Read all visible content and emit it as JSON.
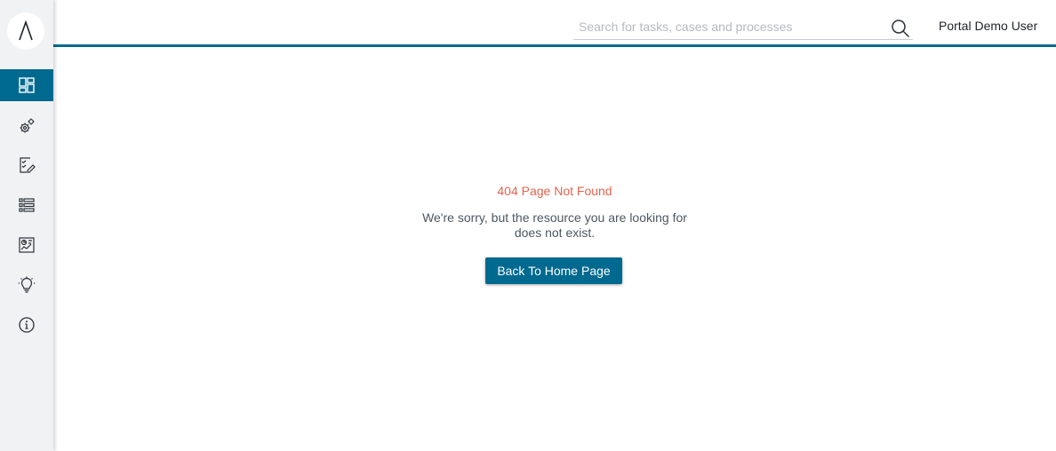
{
  "header": {
    "search": {
      "placeholder": "Search for tasks, cases and processes",
      "value": ""
    },
    "user_name": "Portal Demo User"
  },
  "sidebar": {
    "items": [
      {
        "name": "dashboard",
        "icon": "dashboard-icon",
        "active": true
      },
      {
        "name": "processes",
        "icon": "gears-icon",
        "active": false
      },
      {
        "name": "tasks",
        "icon": "task-checklist-icon",
        "active": false
      },
      {
        "name": "cases",
        "icon": "list-icon",
        "active": false
      },
      {
        "name": "statistics",
        "icon": "chart-board-icon",
        "active": false
      },
      {
        "name": "ideas",
        "icon": "lightbulb-icon",
        "active": false
      },
      {
        "name": "about",
        "icon": "info-icon",
        "active": false
      }
    ]
  },
  "error": {
    "title": "404 Page Not Found",
    "message": "We're sorry, but the resource you are looking for does not exist.",
    "button_label": "Back To Home Page"
  },
  "colors": {
    "accent": "#00698f",
    "error": "#e0654e",
    "sidebar_bg": "#f0f2f3"
  }
}
